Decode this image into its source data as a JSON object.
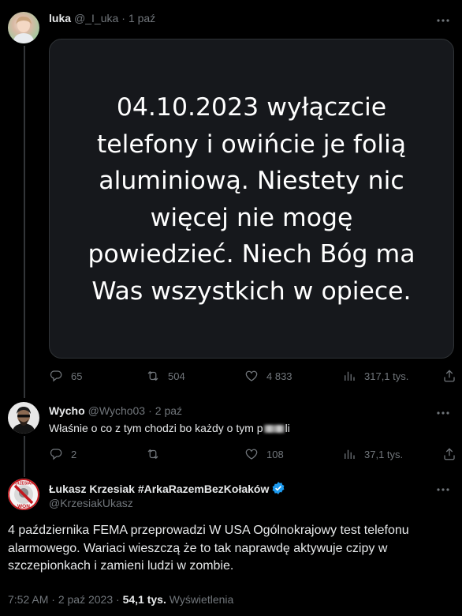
{
  "tweet1": {
    "name": "luka",
    "handle": "@_I_uka",
    "separator": "·",
    "time": "1 paź",
    "image_text": "04.10.2023 wyłączcie telefony i owińcie je folią aluminiową. Niestety nic więcej nie mogę powiedzieć. Niech Bóg ma Was wszystkich w opiece.",
    "stats": {
      "replies": "65",
      "retweets": "504",
      "likes": "4 833",
      "views": "317,1 tys."
    }
  },
  "tweet2": {
    "name": "Wycho",
    "handle": "@Wycho03",
    "separator": "·",
    "time": "2 paź",
    "text_before": "Właśnie o co z tym chodzi bo każdy o tym p",
    "text_after": "li",
    "stats": {
      "replies": "2",
      "retweets": "",
      "likes": "108",
      "views": "37,1 tys."
    }
  },
  "main_tweet": {
    "name": "Łukasz Krzesiak #ArkaRazemBezKołaków",
    "handle": "@KrzesiakUkasz",
    "avatar_text_top": "KRZESIAK",
    "avatar_text_bottom": "WON",
    "text": "4 października FEMA przeprowadzi W USA Ogólnokrajowy test telefonu alarmowego. Wariaci wieszczą że to tak naprawdę aktywuje czipy w szczepionkach i zamieni ludzi w zombie.",
    "time": "7:52 AM",
    "date": "2 paź 2023",
    "views": "54,1 tys.",
    "views_label": "Wyświetlenia",
    "separator": "·"
  },
  "colors": {
    "background": "#000000",
    "text": "#e7e9ea",
    "muted": "#71767b",
    "verified": "#1d9bf0",
    "border": "#2f3336"
  }
}
